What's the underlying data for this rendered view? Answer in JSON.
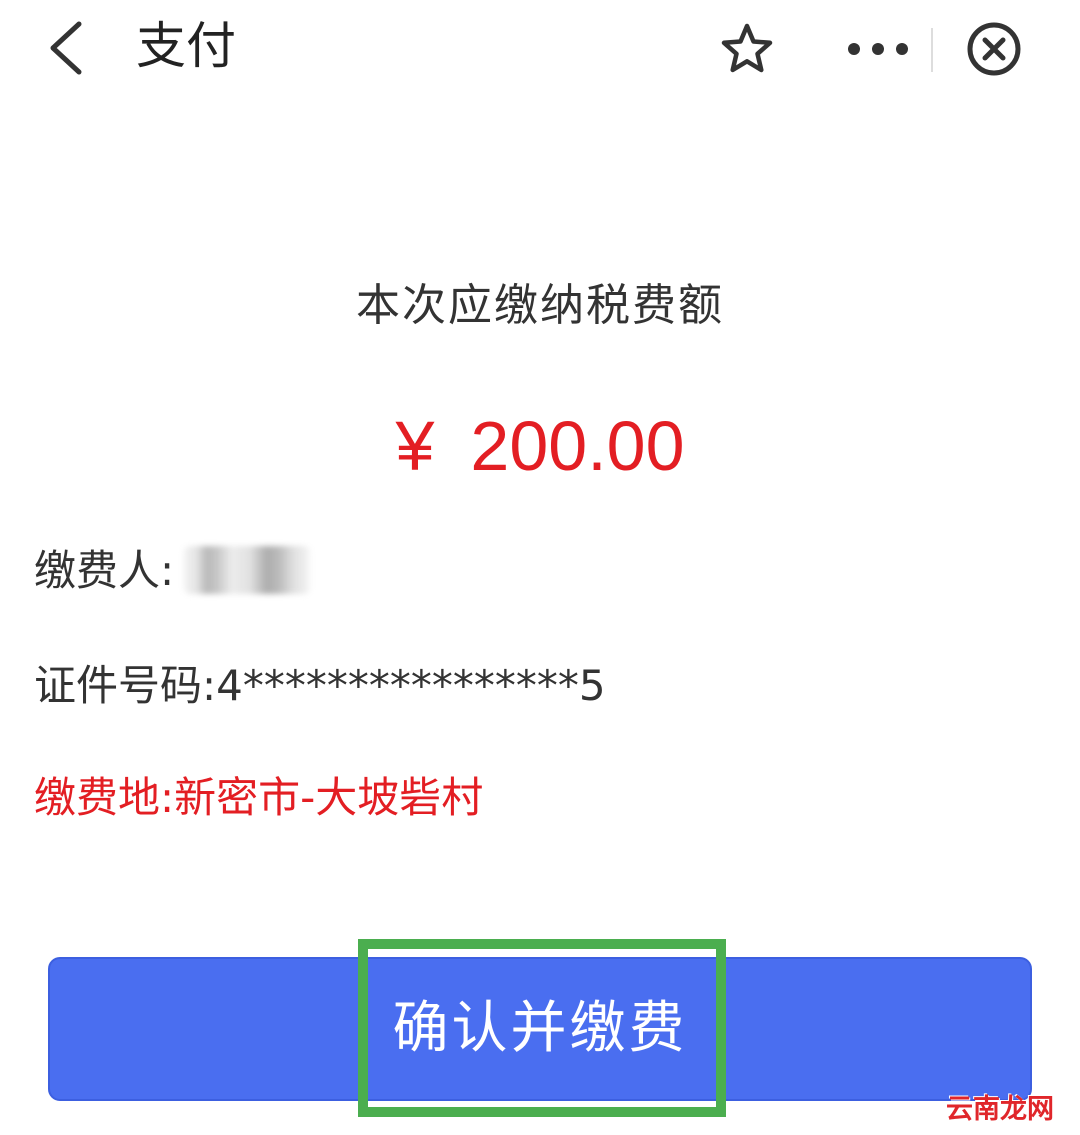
{
  "nav": {
    "title": "支付",
    "icons": [
      "back-chevron",
      "star-outline",
      "more-dots",
      "close-circle"
    ]
  },
  "payment": {
    "amount_label": "本次应缴纳税费额",
    "currency_symbol": "¥",
    "amount": "200.00"
  },
  "info": {
    "payer_label": "缴费人:",
    "payer_value_redacted": true,
    "id_label": "证件号码:",
    "id_value": "4****************5",
    "place_label": "缴费地:",
    "place_value": "新密市-大坡砦村"
  },
  "actions": {
    "confirm_label": "确认并缴费"
  },
  "watermark": {
    "text": "云南龙网"
  },
  "colors": {
    "amount_red": "#e31e23",
    "button_blue": "#4a6ef0",
    "highlight_green": "#4bae4f"
  }
}
